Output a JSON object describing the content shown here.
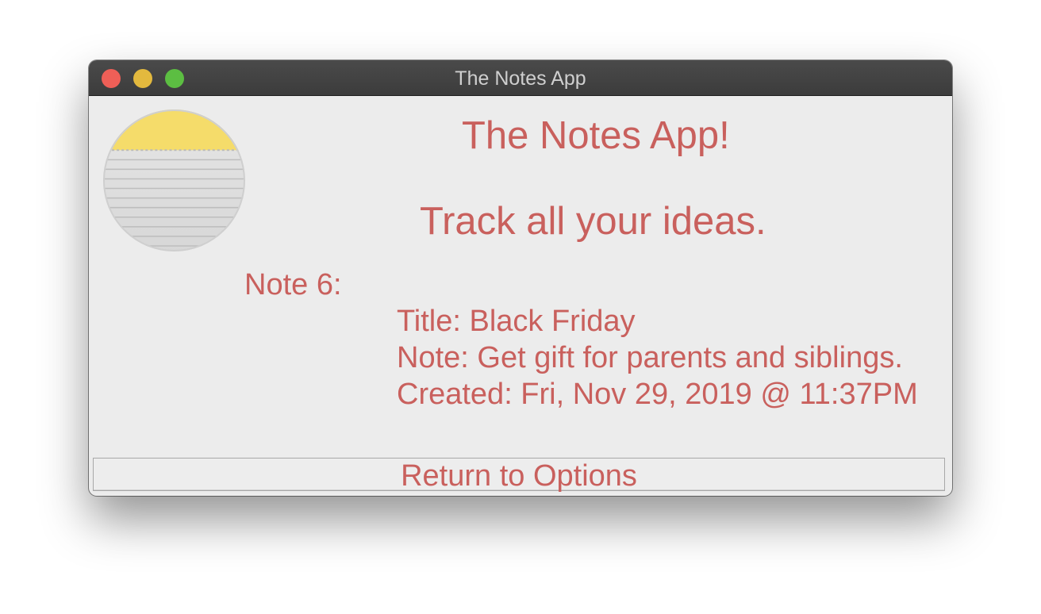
{
  "window": {
    "title": "The Notes App"
  },
  "app": {
    "icon": "notes-app-icon",
    "heading": "The Notes App!",
    "tagline": "Track all your ideas."
  },
  "note": {
    "label": "Note 6:",
    "title_line": "Title: Black Friday",
    "note_line": "Note: Get gift for parents and siblings.",
    "created_line": "Created: Fri, Nov 29, 2019 @ 11:37PM"
  },
  "actions": {
    "return_label": "Return to Options"
  },
  "colors": {
    "accent_text": "#c9605d",
    "background": "#ececec",
    "titlebar": "#3f3f3f",
    "close": "#ee5f57",
    "minimize": "#e3b93e",
    "maximize": "#5cbe42"
  }
}
